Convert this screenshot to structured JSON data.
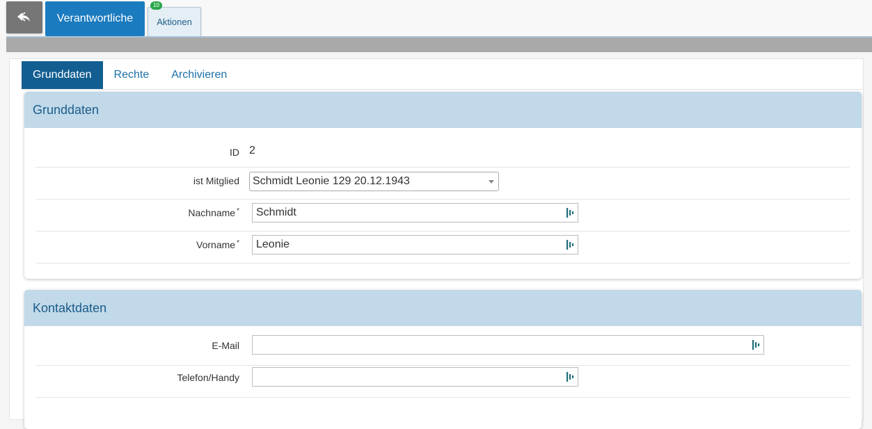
{
  "toolbar": {
    "back_icon": "reply-arrow-icon",
    "main_label": "Verantwortliche",
    "actions_label": "Aktionen",
    "actions_badge": "10",
    "accent": "#1b7bbf",
    "badge_color": "#2aa74a"
  },
  "tabs": [
    {
      "label": "Grunddaten",
      "active": true
    },
    {
      "label": "Rechte",
      "active": false
    },
    {
      "label": "Archivieren",
      "active": false
    }
  ],
  "grunddaten": {
    "title": "Grunddaten",
    "id_label": "ID",
    "id_value": "2",
    "mitglied_label": "ist Mitglied",
    "mitglied_value": "Schmidt Leonie 129 20.12.1943",
    "nachname_label": "Nachname",
    "nachname_value": "Schmidt",
    "vorname_label": "Vorname",
    "vorname_value": "Leonie",
    "required_mark": "*"
  },
  "kontakt": {
    "title": "Kontaktdaten",
    "email_label": "E-Mail",
    "email_value": "",
    "telefon_label": "Telefon/Handy",
    "telefon_value": ""
  },
  "icons": {
    "field_icon": "text-format-icon",
    "field_icon_color": "#1f6f7a"
  }
}
